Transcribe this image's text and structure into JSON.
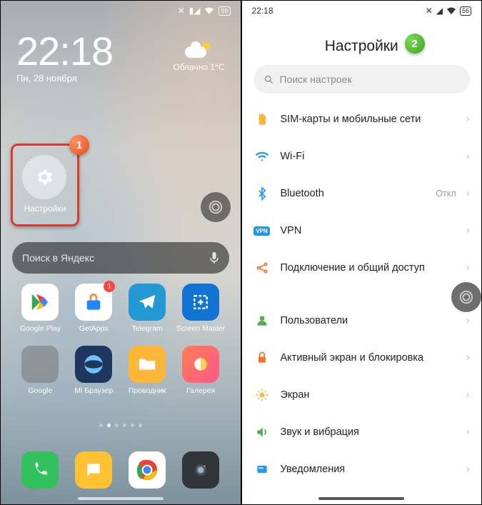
{
  "badges": {
    "one": "1",
    "two": "2"
  },
  "left": {
    "status": {
      "battery": "56"
    },
    "clock": {
      "time": "22:18",
      "date": "Пн, 28 ноября"
    },
    "weather": {
      "cond": "Облачно",
      "temp": "1°C"
    },
    "settings_app": {
      "label": "Настройки"
    },
    "search": {
      "placeholder": "Поиск в Яндекс"
    },
    "apps": {
      "play": "Google Play",
      "getapps": "GetApps",
      "getapps_badge": "1",
      "telegram": "Telegram",
      "screenmaster": "Screen Master",
      "google_folder": "Google",
      "browser": "Mi Браузер",
      "files": "Проводник",
      "gallery": "Галерея"
    }
  },
  "right": {
    "status": {
      "time": "22:18",
      "battery": "56"
    },
    "title": "Настройки",
    "search": {
      "placeholder": "Поиск настроек"
    },
    "rows": {
      "sim": {
        "label": "SIM-карты и мобильные сети"
      },
      "wifi": {
        "label": "Wi-Fi",
        "status": ""
      },
      "bt": {
        "label": "Bluetooth",
        "status": "Откл"
      },
      "vpn": {
        "label": "VPN"
      },
      "share": {
        "label": "Подключение и общий доступ"
      },
      "users": {
        "label": "Пользователи"
      },
      "lock": {
        "label": "Активный экран и блокировка"
      },
      "screen": {
        "label": "Экран"
      },
      "sound": {
        "label": "Звук и вибрация"
      },
      "notif": {
        "label": "Уведомления"
      }
    }
  }
}
